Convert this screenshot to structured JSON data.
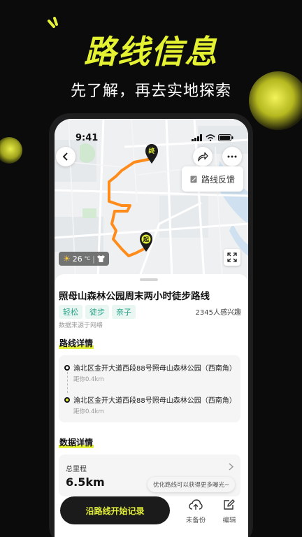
{
  "hero": {
    "title": "路线信息",
    "subtitle": "先了解，再去实地探索"
  },
  "status_bar": {
    "time": "9:41"
  },
  "map": {
    "start_marker": "起",
    "end_marker": "终",
    "weather": {
      "temperature": "26",
      "unit": "°C"
    },
    "feedback_label": "路线反馈"
  },
  "route": {
    "title": "照母山森林公园周末两小时徒步路线",
    "tags": [
      "轻松",
      "徒步",
      "亲子"
    ],
    "interest_count": "2345人感兴趣",
    "source": "数据来源于网络"
  },
  "route_detail": {
    "title": "路线详情",
    "stops": [
      {
        "address": "渝北区金开大道西段88号照母山森林公园（西南角）",
        "distance": "距你0.4km"
      },
      {
        "address": "渝北区金开大道西段88号照母山森林公园（西南角）",
        "distance": "距你0.4km"
      }
    ]
  },
  "data_detail": {
    "title": "数据详情",
    "total_distance_label": "总里程",
    "total_distance_value": "6.5km"
  },
  "tooltip": "优化路线可以获得更多曝光~",
  "bottom_bar": {
    "start_label": "沿路线开始记录",
    "backup_label": "未备份",
    "edit_label": "编辑"
  },
  "colors": {
    "accent": "#e3ef39",
    "route": "#ff8c1a",
    "tag_text": "#2aa38b"
  }
}
